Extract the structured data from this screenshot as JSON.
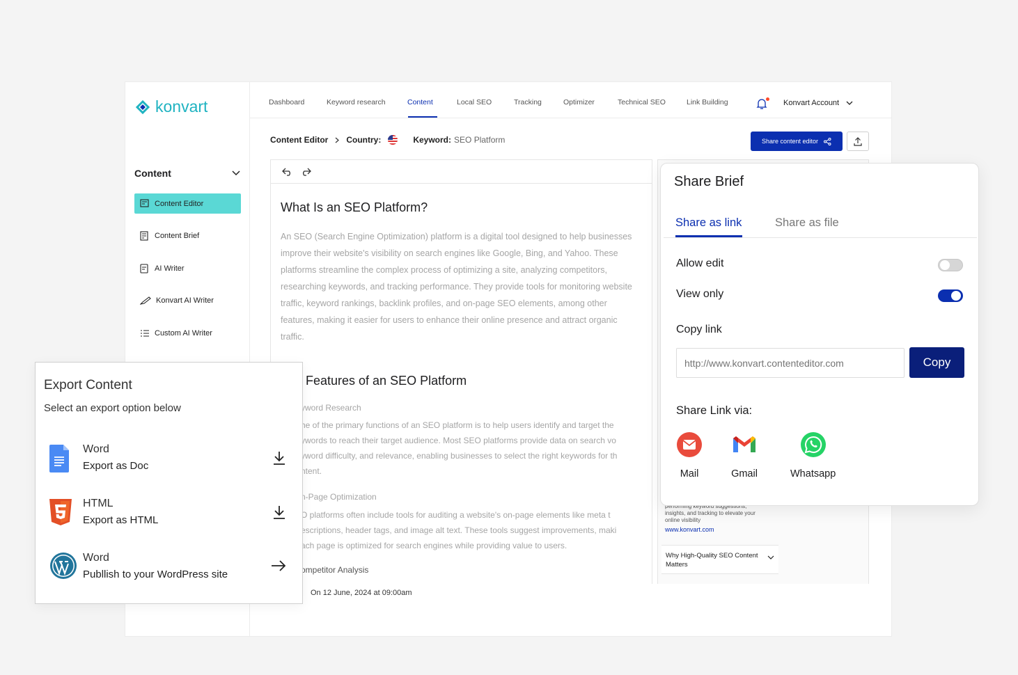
{
  "brand": {
    "name": "konvart",
    "accent": "#1fb3c1",
    "primary": "#0b2fb0"
  },
  "sidebar": {
    "section": "Content",
    "items": [
      {
        "label": "Content Editor",
        "active": true
      },
      {
        "label": "Content Brief"
      },
      {
        "label": "AI Writer"
      },
      {
        "label": "Konvart AI Writer"
      },
      {
        "label": "Custom AI Writer"
      }
    ]
  },
  "nav": {
    "items": [
      "Dashboard",
      "Keyword research",
      "Content",
      "Local SEO",
      "Tracking",
      "Optimizer",
      "Technical SEO",
      "Link Building"
    ],
    "active": "Content",
    "account": "Konvart Account"
  },
  "breadcrumb": {
    "editor": "Content Editor",
    "country_label": "Country:",
    "keyword_label": "Keyword:",
    "keyword_value": "SEO Platform"
  },
  "toolbar": {
    "share_label": "Share content editor"
  },
  "editor": {
    "h1": "What Is an SEO Platform?",
    "p1": "An SEO (Search Engine Optimization) platform is a digital tool designed to help businesses improve their website's visibility on search engines like Google, Bing, and Yahoo. These platforms streamline the complex process of optimizing a site, analyzing competitors, researching keywords, and tracking performance. They provide tools for monitoring website traffic, keyword rankings, backlink profiles, and on-page SEO elements, among other features, making it easier for users to enhance their online presence and attract organic traffic.",
    "h2": "Features of an SEO Platform",
    "s1_title": "yword Research",
    "s1_l1": "he of the primary functions of an SEO platform is to help users identify and target the",
    "s1_l2": "ywords to reach their target audience. Most SEO platforms provide data on search vo",
    "s1_l3": "yword difficulty, and relevance, enabling businesses to select the right keywords for th",
    "s1_l4": "ntent.",
    "s2_title": "n-Page Optimization",
    "s2_l1": "O platforms often include tools for auditing a website's on-page elements like meta t",
    "s2_l2": "escriptions, header tags, and image alt text. These tools suggest improvements, maki",
    "s2_l3": "ach page is optimized for search engines while providing value to users.",
    "s3_title": "ompetitor Analysis",
    "date": "On 12 June, 2024 at 09:00am"
  },
  "faq": {
    "text": "performing keyword suggestions, insights, and tracking to elevate your online visibility",
    "link": "www.konvart.com",
    "item1": "Why High-Quality SEO Content Matters"
  },
  "export": {
    "title": "Export Content",
    "subtitle": "Select an export option below",
    "options": [
      {
        "name": "Word",
        "desc": "Export as Doc",
        "icon": "google-docs-icon"
      },
      {
        "name": "HTML",
        "desc": "Export as HTML",
        "icon": "html5-icon"
      },
      {
        "name": "Word",
        "desc": "Publlish to  your WordPress site",
        "icon": "wordpress-icon"
      }
    ]
  },
  "share": {
    "title": "Share Brief",
    "tab_link": "Share as link",
    "tab_file": "Share as file",
    "allow_edit": "Allow edit",
    "allow_edit_on": false,
    "view_only": "View only",
    "view_only_on": true,
    "copy_link_label": "Copy link",
    "link_placeholder": "http://www.konvart.contenteditor.com",
    "copy_button": "Copy",
    "via_title": "Share Link via:",
    "via": [
      "Mail",
      "Gmail",
      "Whatsapp"
    ]
  }
}
